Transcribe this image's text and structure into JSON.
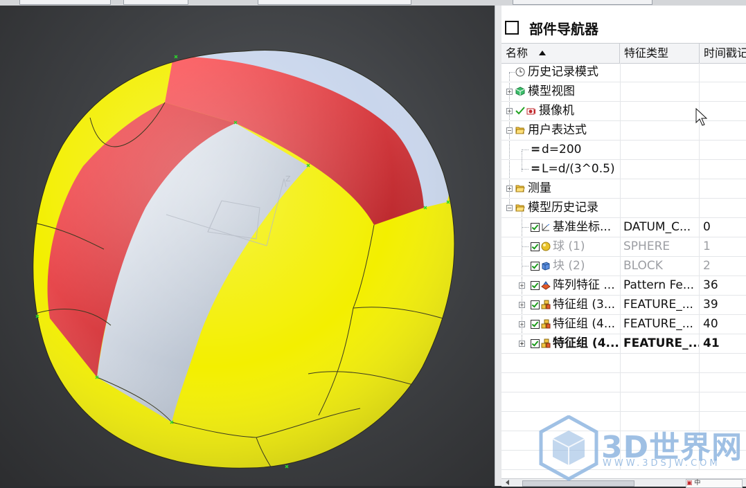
{
  "colors": {
    "ball_yellow": "#f3ef00",
    "ball_red": "#e8383d",
    "ball_white": "#d8e3f2",
    "viewport_bg": "#3d3f42",
    "watermark": "#8fb6e0"
  },
  "navigator": {
    "title": "部件导航器",
    "columns": {
      "name": "名称",
      "type": "特征类型",
      "time": "时间戳记"
    },
    "rows": [
      {
        "name": "历史记录模式",
        "type": "",
        "time": "",
        "icon": "clock-icon"
      },
      {
        "name": "模型视图",
        "type": "",
        "time": "",
        "icon": "model-views-icon"
      },
      {
        "name": "摄像机",
        "type": "",
        "time": "",
        "icon": "camera-icon"
      },
      {
        "name": "用户表达式",
        "type": "",
        "time": "",
        "icon": "folder-open-icon"
      },
      {
        "name": "d=200",
        "type": "",
        "time": "",
        "icon": "expression-icon"
      },
      {
        "name": "L=d/(3^0.5)",
        "type": "",
        "time": "",
        "icon": "expression-icon"
      },
      {
        "name": "测量",
        "type": "",
        "time": "",
        "icon": "folder-icon"
      },
      {
        "name": "模型历史记录",
        "type": "",
        "time": "",
        "icon": "folder-open-icon"
      },
      {
        "name": "基准坐标...",
        "type": "DATUM_C...",
        "time": "0",
        "icon": "datum-csys-icon"
      },
      {
        "name": "球 (1)",
        "type": "SPHERE",
        "time": "1",
        "icon": "sphere-icon"
      },
      {
        "name": "块 (2)",
        "type": "BLOCK",
        "time": "2",
        "icon": "block-icon"
      },
      {
        "name": "阵列特征 ...",
        "type": "Pattern Fe...",
        "time": "36",
        "icon": "pattern-icon"
      },
      {
        "name": "特征组 (3...",
        "type": "FEATURE_...",
        "time": "39",
        "icon": "feature-group-icon"
      },
      {
        "name": "特征组 (4...",
        "type": "FEATURE_...",
        "time": "40",
        "icon": "feature-group-icon"
      },
      {
        "name": "特征组 (4...",
        "type": "FEATURE_...",
        "time": "41",
        "icon": "feature-group-icon"
      }
    ],
    "scroll_button": "中"
  },
  "viewport": {
    "axis_label": "Z"
  },
  "watermark": {
    "text": "3D世界网",
    "sub": "WWW.3DSJW.COM"
  }
}
